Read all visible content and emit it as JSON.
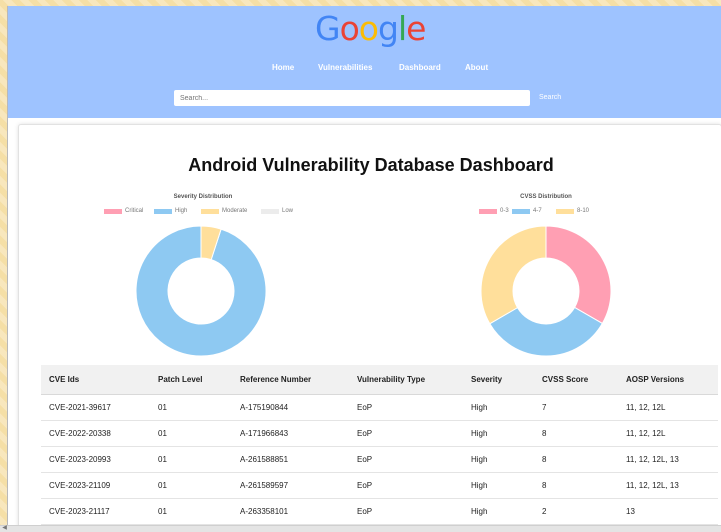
{
  "logo": {
    "letters": [
      {
        "char": "G",
        "color": "#4285F4"
      },
      {
        "char": "o",
        "color": "#EA4335"
      },
      {
        "char": "o",
        "color": "#FBBC05"
      },
      {
        "char": "g",
        "color": "#4285F4"
      },
      {
        "char": "l",
        "color": "#34A853"
      },
      {
        "char": "e",
        "color": "#EA4335"
      }
    ]
  },
  "nav": {
    "items": [
      "Home",
      "Vulnerabilities",
      "Dashboard",
      "About"
    ]
  },
  "search": {
    "placeholder": "Search...",
    "button_label": "Search"
  },
  "dashboard": {
    "title": "Android Vulnerability Database Dashboard"
  },
  "chart_data": [
    {
      "type": "doughnut",
      "title": "Severity Distribution",
      "legend_position": "top",
      "categories": [
        "Critical",
        "High",
        "Moderate",
        "Low"
      ],
      "values": [
        0,
        95,
        5,
        0
      ],
      "colors": [
        "#ff9fb3",
        "#8ec9f2",
        "#ffdf9b",
        "#ececec"
      ]
    },
    {
      "type": "doughnut",
      "title": "CVSS Distribution",
      "legend_position": "top",
      "categories": [
        "0-3",
        "4-7",
        "8-10"
      ],
      "values": [
        33.3,
        33.3,
        33.4
      ],
      "colors": [
        "#ff9fb3",
        "#8ec9f2",
        "#ffdf9b"
      ]
    }
  ],
  "table": {
    "headers": [
      "CVE Ids",
      "Patch Level",
      "Reference Number",
      "Vulnerability Type",
      "Severity",
      "CVSS Score",
      "AOSP Versions"
    ],
    "rows": [
      [
        "CVE-2021-39617",
        "01",
        "A-175190844",
        "EoP",
        "High",
        "7",
        "11, 12, 12L"
      ],
      [
        "CVE-2022-20338",
        "01",
        "A-171966843",
        "EoP",
        "High",
        "8",
        "11, 12, 12L"
      ],
      [
        "CVE-2023-20993",
        "01",
        "A-261588851",
        "EoP",
        "High",
        "8",
        "11, 12, 12L, 13"
      ],
      [
        "CVE-2023-21109",
        "01",
        "A-261589597",
        "EoP",
        "High",
        "8",
        "11, 12, 12L, 13"
      ],
      [
        "CVE-2023-21117",
        "01",
        "A-263358101",
        "EoP",
        "High",
        "2",
        "13"
      ]
    ]
  }
}
